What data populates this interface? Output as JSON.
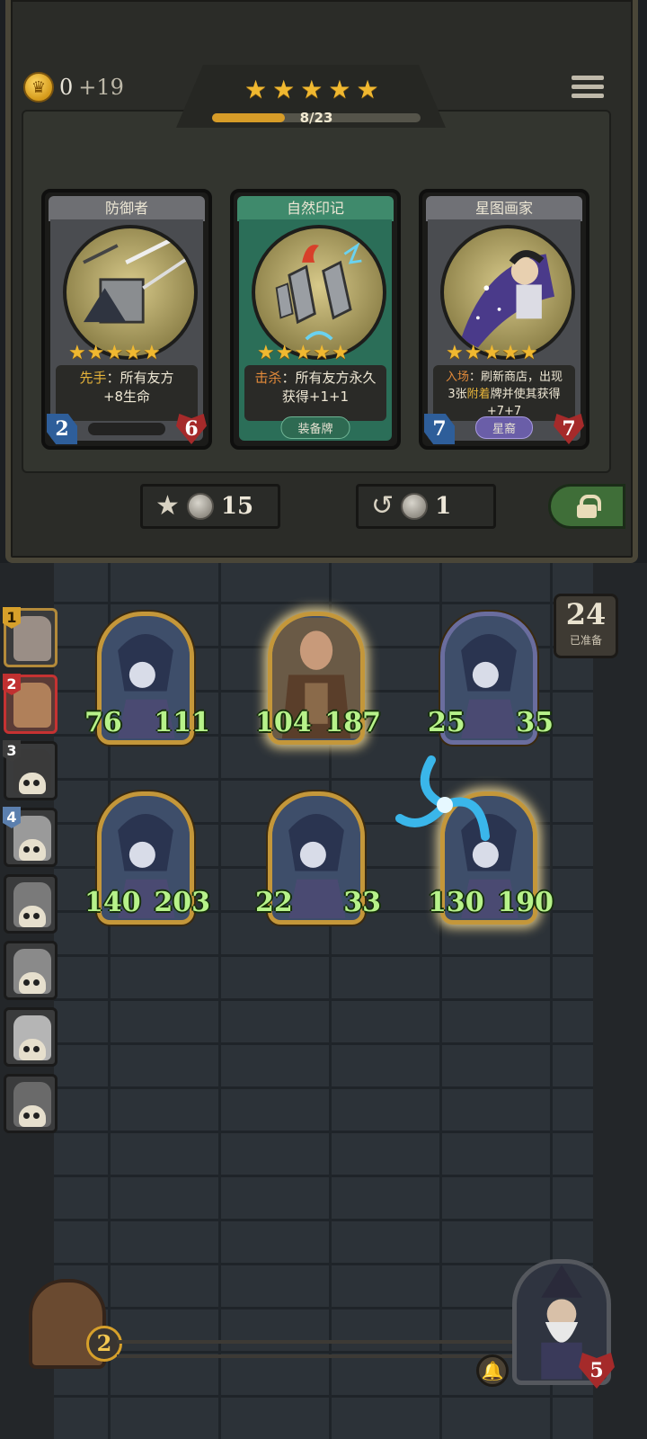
{
  "header": {
    "gold": "0",
    "gold_income": "+19",
    "tier_stars": 5,
    "xp_text": "8/23",
    "xp_progress": 0.348
  },
  "shop": {
    "cards": [
      {
        "name": "防御者",
        "keyword": "先手",
        "text": "：所有友方",
        "text2": "+8生命",
        "attack": "2",
        "health": "6",
        "stars": 5,
        "tag": ""
      },
      {
        "name": "自然印记",
        "keyword": "击杀",
        "text": "：所有友方永久",
        "text2": "获得+1+1",
        "attack": "",
        "health": "",
        "stars": 5,
        "tag": "装备牌"
      },
      {
        "name": "星图画家",
        "keyword": "入场",
        "text": "：刷新商店，出现",
        "text_mid_a": "3张",
        "text_mid_kw": "附着",
        "text_mid_b": "牌并使其获得",
        "text3": "+7+7",
        "attack": "7",
        "health": "7",
        "stars": 5,
        "tag": "星裔"
      }
    ],
    "upgrade_cost": "15",
    "refresh_cost": "1"
  },
  "board": {
    "ready_count": "24",
    "ready_label": "已准备",
    "opponents": [
      {
        "rank": "1"
      },
      {
        "rank": "2"
      },
      {
        "rank": "3"
      },
      {
        "rank": "4"
      },
      {
        "rank": ""
      },
      {
        "rank": ""
      },
      {
        "rank": ""
      },
      {
        "rank": ""
      }
    ],
    "minions": [
      {
        "attack": "76",
        "health": "111"
      },
      {
        "attack": "104",
        "health": "187"
      },
      {
        "attack": "25",
        "health": "35"
      },
      {
        "attack": "140",
        "health": "203"
      },
      {
        "attack": "22",
        "health": "33"
      },
      {
        "attack": "130",
        "health": "190"
      }
    ]
  },
  "footer": {
    "chest_count": "2",
    "player_health": "5"
  },
  "colors": {
    "gold": "#f0b830",
    "stat_green": "#b7f28a",
    "health_red": "#a52a2a",
    "attack_blue": "#2e5e9a"
  }
}
